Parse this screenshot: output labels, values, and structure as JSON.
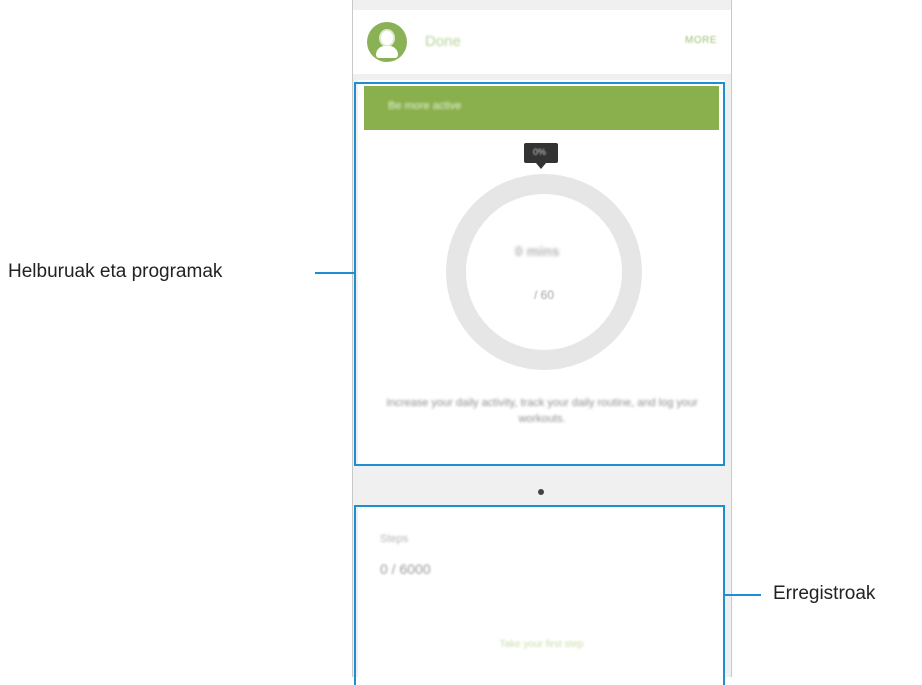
{
  "app": {
    "title": "Done",
    "more_label": "MORE"
  },
  "goal_card": {
    "header": "Be more active",
    "tooltip": "0%",
    "current_value": "0 mins",
    "target": "/ 60",
    "description": "Increase your daily activity, track your daily routine, and log your workouts."
  },
  "page_indicator": {
    "total": 1,
    "active": 1
  },
  "records_card": {
    "label": "Steps",
    "value": "0 / 6000",
    "link": "Take your first step"
  },
  "callouts": {
    "goals": "Helburuak eta programak",
    "records": "Erregistroak"
  },
  "colors": {
    "accent_green": "#89b04c",
    "callout_blue": "#1f8fd1",
    "ring_gray": "#e6e6e6"
  },
  "icons": {
    "avatar": "profile-avatar-icon"
  }
}
